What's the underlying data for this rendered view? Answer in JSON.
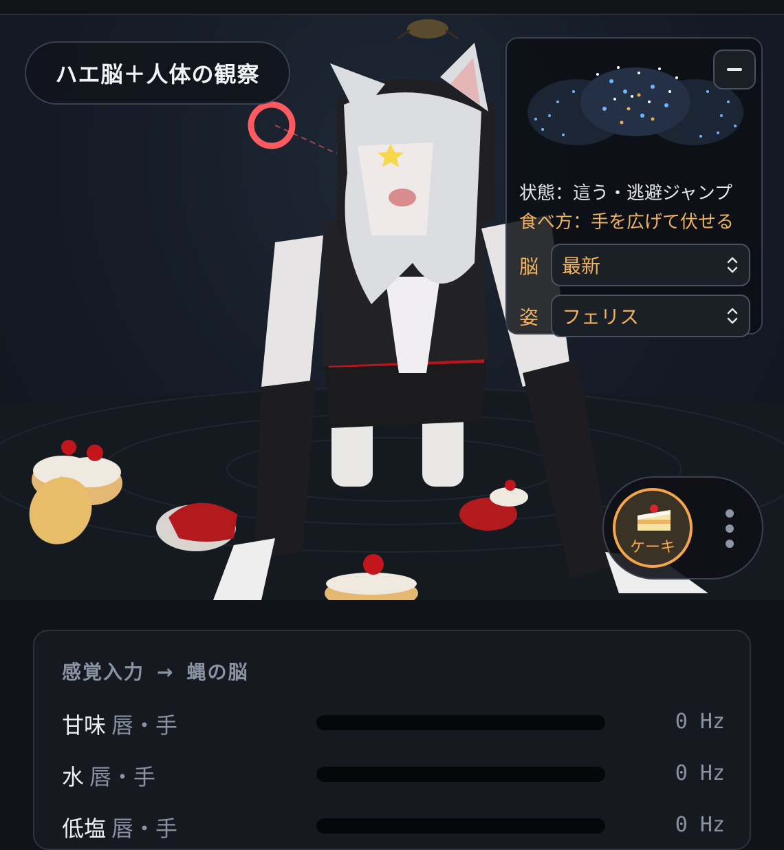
{
  "title": "ハエ脳＋人体の観察",
  "panel": {
    "state": "状態：這う・逃避ジャンプ",
    "eating": "食べ方：手を広げて伏せる",
    "brain_label": "脳",
    "brain_value": "最新",
    "pose_label": "姿",
    "pose_value": "フェリス",
    "collapse_icon": "minus-icon"
  },
  "food": {
    "label": "ケーキ",
    "icon": "cake-icon",
    "more_icon": "more-vertical-icon"
  },
  "sensors": {
    "heading_left": "感覚入力",
    "heading_arrow": "→",
    "heading_right": "蝿の脳",
    "rows": [
      {
        "name": "甘味",
        "sub": "唇・手",
        "level": 0,
        "value": "0 Hz"
      },
      {
        "name": "水",
        "sub": "唇・手",
        "level": 0,
        "value": "0 Hz"
      },
      {
        "name": "低塩",
        "sub": "唇・手",
        "level": 0,
        "value": "0 Hz"
      }
    ]
  },
  "colors": {
    "accent": "#f0b25e",
    "ring": "#f5a64a",
    "target": "#ff5a5f"
  }
}
